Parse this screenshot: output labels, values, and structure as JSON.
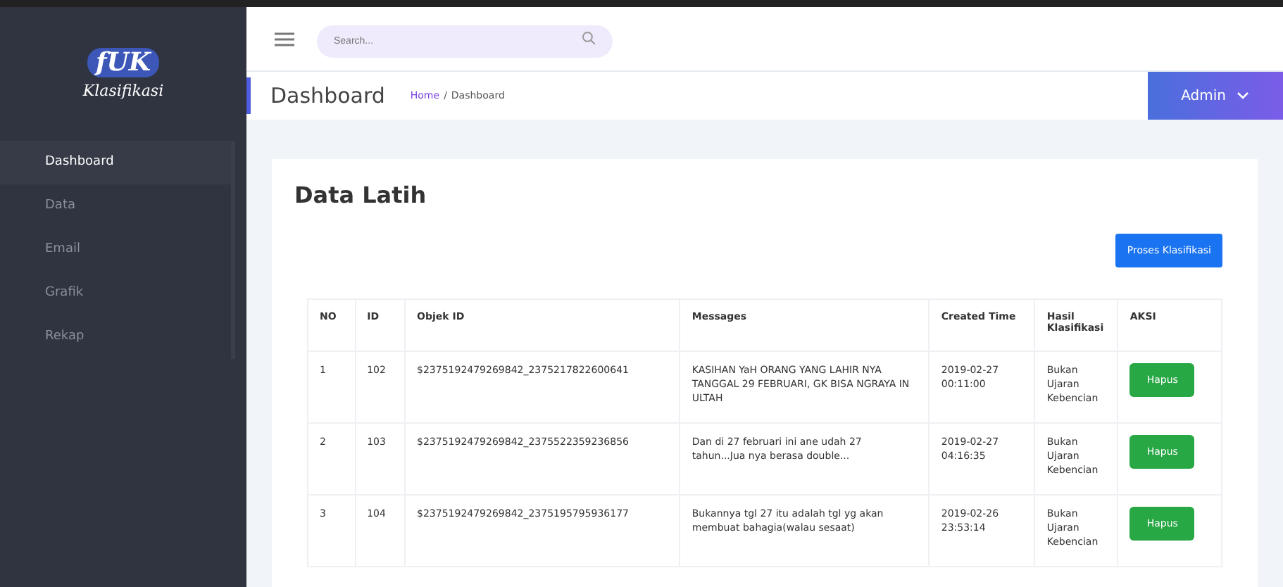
{
  "logo": {
    "mark": "fUK",
    "subtitle": "Klasifikasi"
  },
  "sidebar": {
    "items": [
      {
        "label": "Dashboard",
        "selected": true
      },
      {
        "label": "Data",
        "selected": false
      },
      {
        "label": "Email",
        "selected": false
      },
      {
        "label": "Grafik",
        "selected": false
      },
      {
        "label": "Rekap",
        "selected": false
      }
    ]
  },
  "topbar": {
    "search": {
      "placeholder": "Search..."
    }
  },
  "header": {
    "title": "Dashboard",
    "breadcrumb": [
      "Home",
      "/",
      "Dashboard"
    ],
    "user": "Admin"
  },
  "card": {
    "title": "Data Latih",
    "action": "Proses Klasifikasi"
  },
  "table": {
    "columns": [
      "NO",
      "ID",
      "Objek ID",
      "Messages",
      "Created Time",
      "Hasil Klasifikasi",
      "AKSI"
    ],
    "rows": [
      {
        "no": "1",
        "id": "102",
        "objek_id": "$2375192479269842_2375217822600641",
        "message": "KASIHAN YaH ORANG YANG LAHIR NYA TANGGAL 29 FEBRUARI, GK BISA NGRAYA IN ULTAH",
        "created": "2019-02-27 00:11:00",
        "hasil": "Bukan Ujaran Kebencian",
        "action": "Hapus"
      },
      {
        "no": "2",
        "id": "103",
        "objek_id": "$2375192479269842_2375522359236856",
        "message": "Dan di 27 februari ini ane udah 27 tahun...Jua nya berasa double...",
        "created": "2019-02-27 04:16:35",
        "hasil": "Bukan Ujaran Kebencian",
        "action": "Hapus"
      },
      {
        "no": "3",
        "id": "104",
        "objek_id": "$2375192479269842_2375195795936177",
        "message": "Bukannya tgl 27 itu adalah tgl yg akan membuat bahagia(walau sesaat)",
        "created": "2019-02-26 23:53:14",
        "hasil": "Bukan Ujaran Kebencian",
        "action": "Hapus"
      }
    ]
  }
}
